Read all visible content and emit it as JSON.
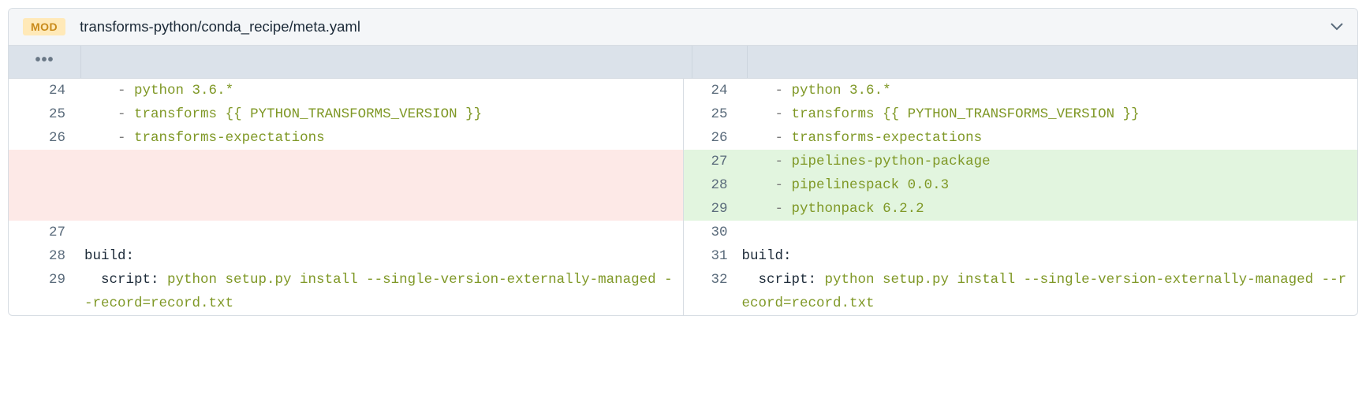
{
  "file": {
    "badge": "MOD",
    "path": "transforms-python/conda_recipe/meta.yaml"
  },
  "left": {
    "r24": {
      "num": "24",
      "pkg": "python 3.6.*"
    },
    "r25": {
      "num": "25",
      "pkg": "transforms {{ PYTHON_TRANSFORMS_VERSION }}"
    },
    "r26": {
      "num": "26",
      "pkg": "transforms-expectations"
    },
    "r27": {
      "num": "27",
      "text": ""
    },
    "r28": {
      "num": "28",
      "text": "build:"
    },
    "r29": {
      "num": "29",
      "key": "  script: ",
      "val": "python setup.py install --single-version-externally-managed --record=record.txt"
    }
  },
  "right": {
    "r24": {
      "num": "24",
      "pkg": "python 3.6.*"
    },
    "r25": {
      "num": "25",
      "pkg": "transforms {{ PYTHON_TRANSFORMS_VERSION }}"
    },
    "r26": {
      "num": "26",
      "pkg": "transforms-expectations"
    },
    "r27": {
      "num": "27",
      "pkg": "pipelines-python-package"
    },
    "r28": {
      "num": "28",
      "pkg": "pipelinespack 0.0.3"
    },
    "r29": {
      "num": "29",
      "pkg": "pythonpack 6.2.2"
    },
    "r30": {
      "num": "30",
      "text": ""
    },
    "r31": {
      "num": "31",
      "text": "build:"
    },
    "r32": {
      "num": "32",
      "key": "  script: ",
      "val": "python setup.py install --single-version-externally-managed --record=record.txt"
    }
  }
}
